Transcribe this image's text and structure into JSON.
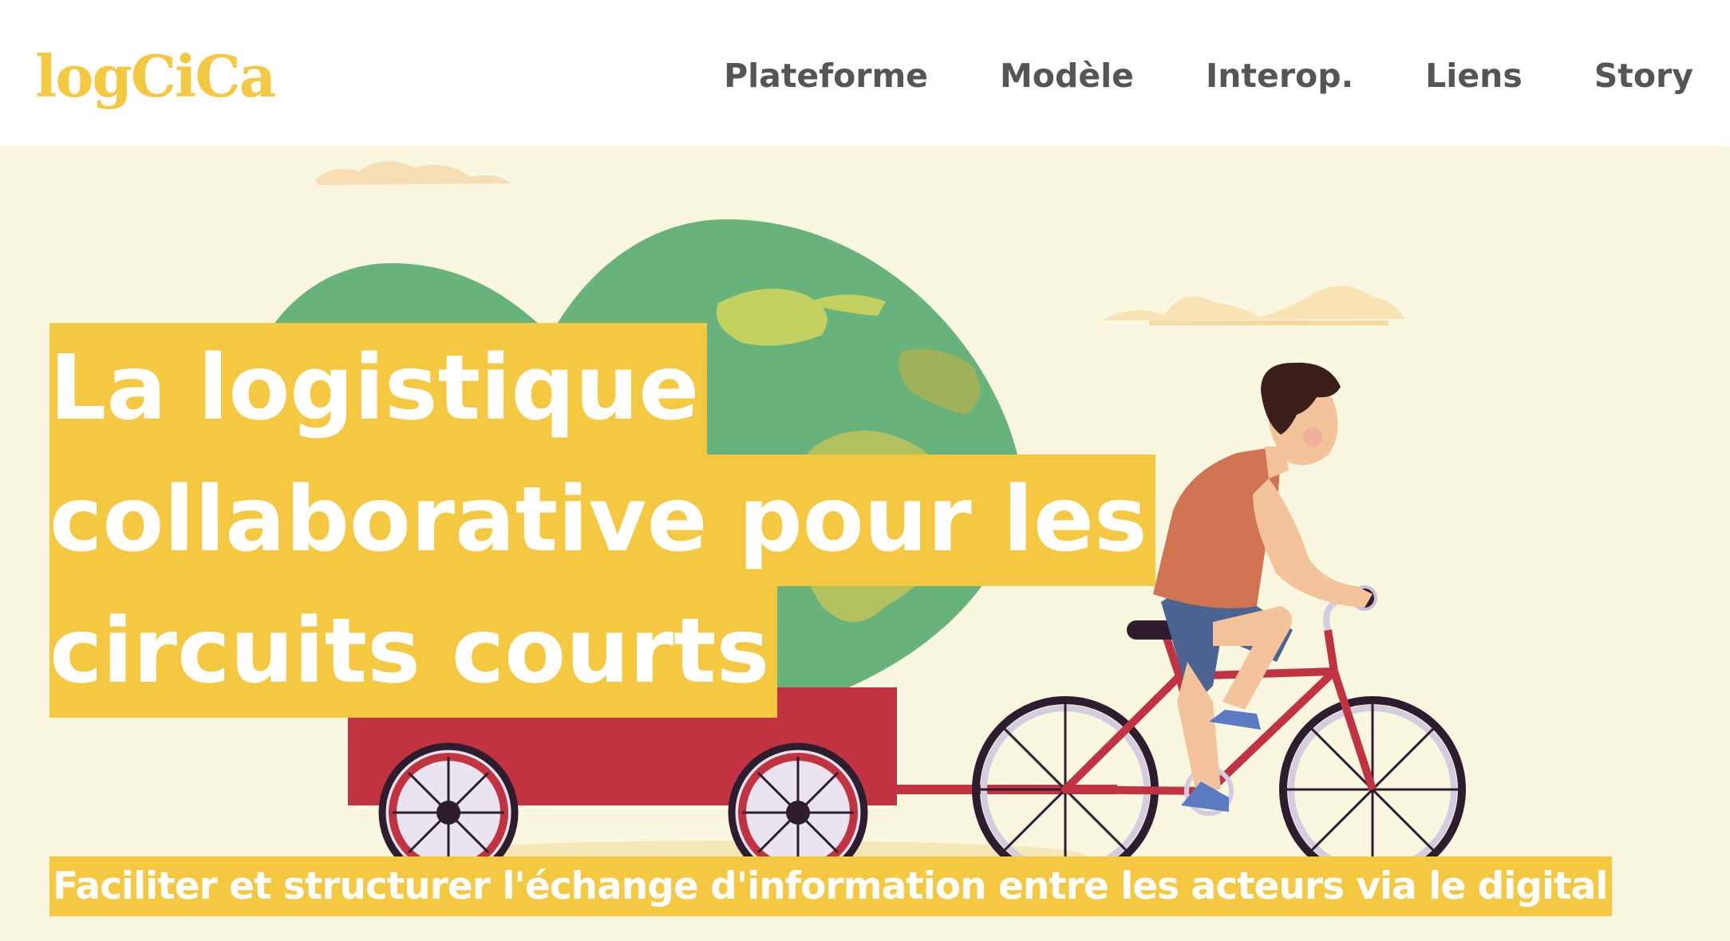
{
  "brand": {
    "logo_text": "logCiCa",
    "logo_color": "#f5c842"
  },
  "nav": {
    "items": [
      {
        "label": "Plateforme"
      },
      {
        "label": "Modèle"
      },
      {
        "label": "Interop."
      },
      {
        "label": "Liens"
      },
      {
        "label": "Story"
      }
    ]
  },
  "hero": {
    "title_lines": [
      "La logistique",
      "collaborative pour les",
      "circuits courts"
    ],
    "subtitle": "Faciliter et structurer l'échange d'information entre les acteurs via le digital",
    "highlight_color": "#f5c842",
    "illustration": {
      "icons": [
        "earth-globe-icon",
        "cart-trailer-icon",
        "cyclist-icon",
        "bicycle-icon",
        "cloud-icon"
      ]
    }
  }
}
